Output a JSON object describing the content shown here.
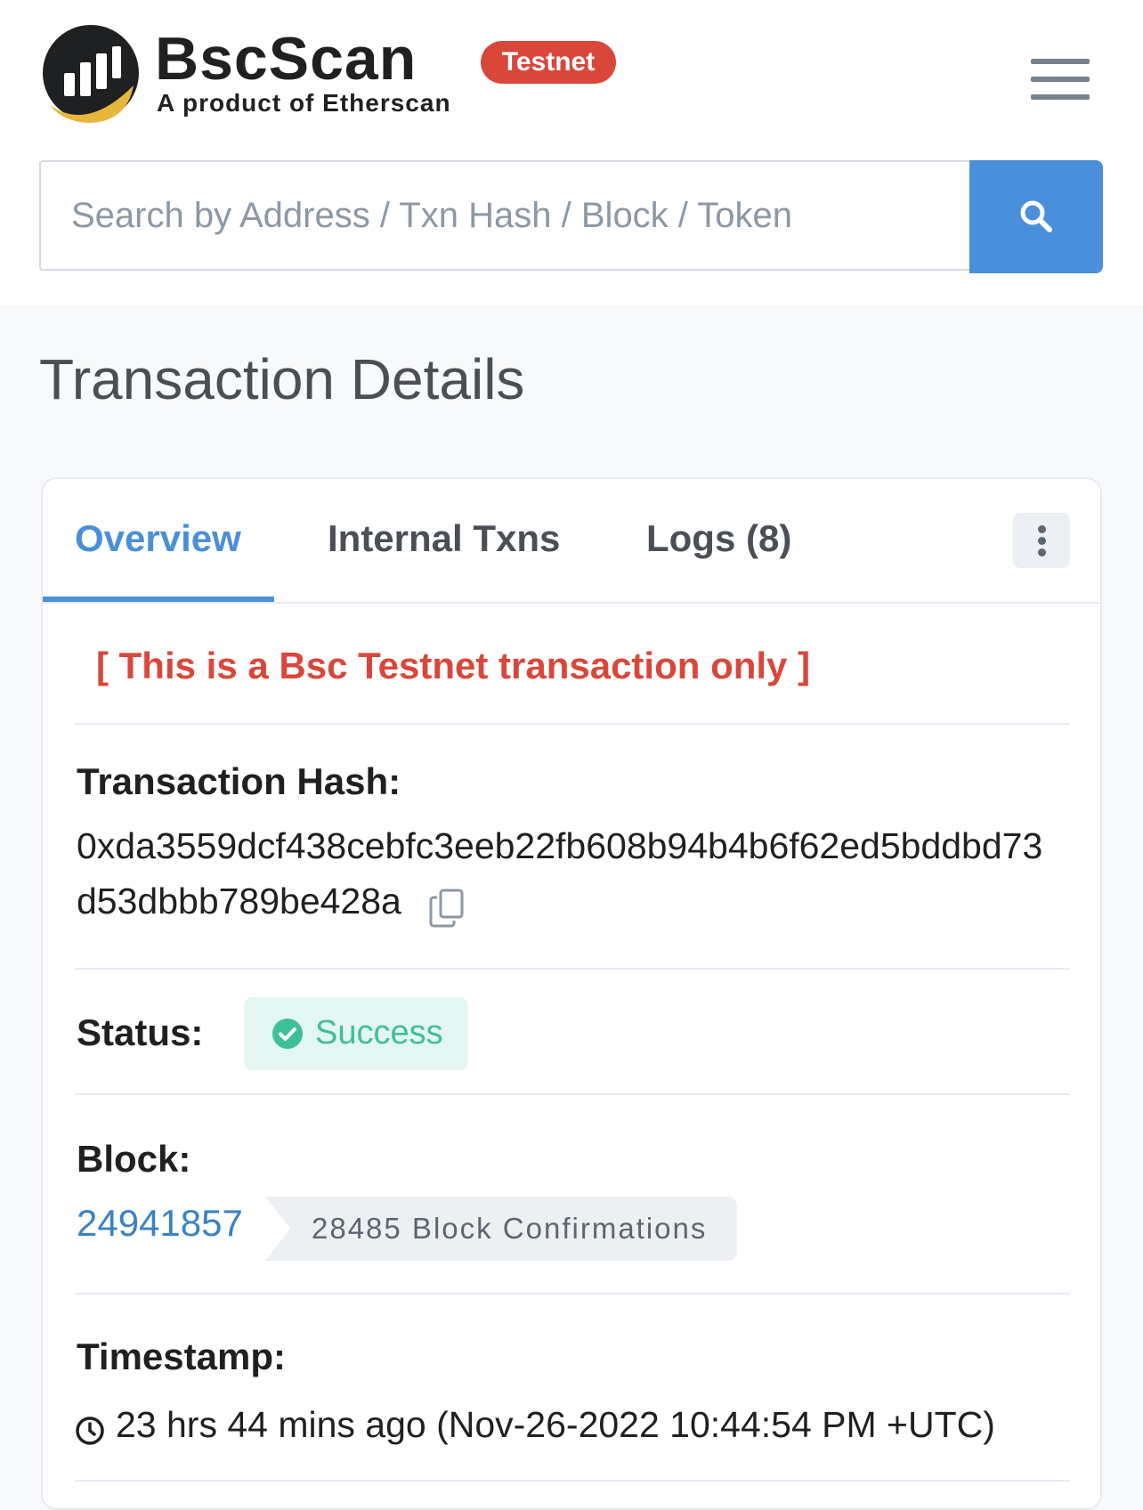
{
  "header": {
    "brand_name": "BscScan",
    "brand_sub": "A product of Etherscan",
    "network_badge": "Testnet",
    "menu_icon": "hamburger-icon"
  },
  "search": {
    "placeholder": "Search by Address / Txn Hash / Block / Token",
    "button_icon": "search-icon"
  },
  "page": {
    "title": "Transaction Details"
  },
  "tabs": [
    {
      "label": "Overview",
      "active": true
    },
    {
      "label": "Internal Txns",
      "active": false
    },
    {
      "label": "Logs (8)",
      "active": false
    }
  ],
  "notice": "[ This is a Bsc Testnet transaction only ]",
  "fields": {
    "hash_label": "Transaction Hash:",
    "hash_line1": "0xda3559dcf438cebfc3eeb22fb608b94b4b6f62ed5bddbd73",
    "hash_line2": "d53dbbb789be428a",
    "status_label": "Status:",
    "status_value": "Success",
    "block_label": "Block:",
    "block_value": "24941857",
    "block_confirmations": "28485 Block Confirmations",
    "timestamp_label": "Timestamp:",
    "timestamp_value": "23 hrs 44 mins ago (Nov-26-2022 10:44:54 PM +UTC)"
  },
  "colors": {
    "accent": "#4a8fd9",
    "badge_red": "#d9473b",
    "success_green": "#3fbf97",
    "logo_gold": "#e8b63c"
  }
}
